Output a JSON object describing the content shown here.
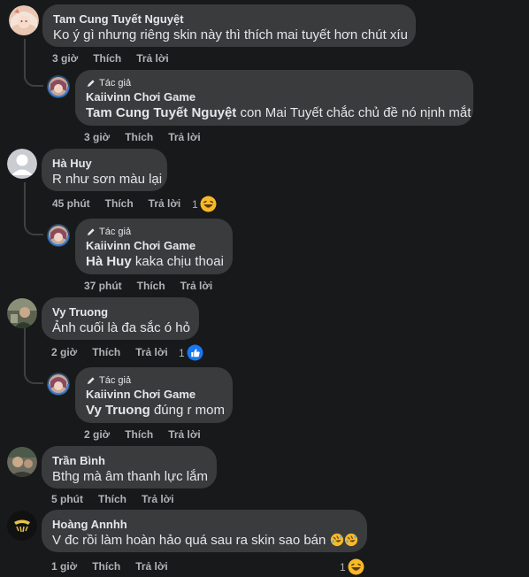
{
  "comments": [
    {
      "author": "Tam Cung Tuyết Nguyệt",
      "text": "Ko ý gì nhưng riêng skin này thì thích mai tuyết hơn chút xíu",
      "time": "3 giờ",
      "like": "Thích",
      "reply": "Trả lời",
      "reply_item": {
        "tag": "Tác giả",
        "author": "Kaiivinn Chơi Game",
        "mention": "Tam Cung Tuyết Nguyệt",
        "text": " con Mai Tuyết chắc chủ đề nó nịnh mắt",
        "time": "3 giờ",
        "like": "Thích",
        "reply": "Trả lời"
      }
    },
    {
      "author": "Hà Huy",
      "text": "R như sơn màu lại",
      "time": "45 phút",
      "like": "Thích",
      "reply": "Trả lời",
      "reaction_count": "1",
      "reaction": "haha-emoji",
      "reply_item": {
        "tag": "Tác giả",
        "author": "Kaiivinn Chơi Game",
        "mention": "Hà Huy",
        "text": " kaka chịu thoai",
        "time": "37 phút",
        "like": "Thích",
        "reply": "Trả lời"
      }
    },
    {
      "author": "Vy Truong",
      "text": "Ảnh cuối là đa sắc ó hỏ",
      "time": "2 giờ",
      "like": "Thích",
      "reply": "Trả lời",
      "reaction_count": "1",
      "reaction": "like-emoji",
      "reply_item": {
        "tag": "Tác giả",
        "author": "Kaiivinn Chơi Game",
        "mention": "Vy Truong",
        "text": " đúng r mom",
        "time": "2 giờ",
        "like": "Thích",
        "reply": "Trả lời"
      }
    },
    {
      "author": "Trần Bình",
      "text": "Bthg mà âm thanh lực lắm",
      "time": "5 phút",
      "like": "Thích",
      "reply": "Trả lời"
    },
    {
      "author": "Hoàng Annhh",
      "text": "V đc rồi làm hoàn hảo quá sau ra skin sao bán",
      "time": "1 giờ",
      "like": "Thích",
      "reply": "Trả lời",
      "reaction_count": "1",
      "reaction": "haha-emoji"
    }
  ],
  "colors": {
    "background": "#18191a",
    "bubble": "#3a3b3c",
    "text": "#e4e6eb",
    "muted": "#b0b3b8",
    "like_blue": "#1877f2",
    "haha_yellow": "#f7b928"
  }
}
